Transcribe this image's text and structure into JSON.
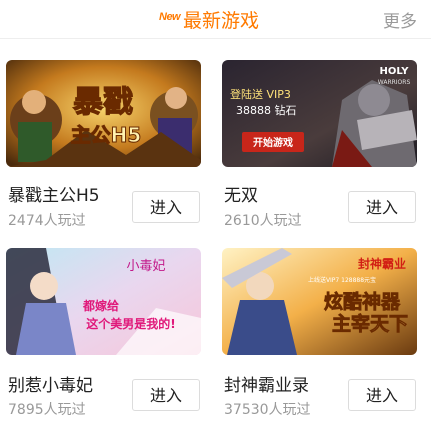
{
  "header": {
    "new_badge": "New",
    "title": "最新游戏",
    "more": "更多"
  },
  "games": [
    {
      "name": "暴戳主公H5",
      "players": "2474人玩过",
      "enter_label": "进入",
      "thumb_text": [
        "暴戳",
        "主公H5"
      ]
    },
    {
      "name": "无双",
      "players": "2610人玩过",
      "enter_label": "进入",
      "thumb_text": [
        "登陆送 VIP3",
        "38888 钻石",
        "开始游戏",
        "HOLY",
        "WARRIORS"
      ]
    },
    {
      "name": "别惹小毒妃",
      "players": "7895人玩过",
      "enter_label": "进入",
      "thumb_text": [
        "小毒妃",
        "都嫁给",
        "这个美男是我的!"
      ]
    },
    {
      "name": "封神霸业录",
      "players": "37530人玩过",
      "enter_label": "进入",
      "thumb_text": [
        "封神霸业",
        "上线送VIP7 128888元宝",
        "炫酷神器",
        "主宰天下"
      ]
    }
  ],
  "colors": {
    "accent": "#ff7a00",
    "muted_text": "#999999",
    "button_border": "#dcdcdc"
  }
}
